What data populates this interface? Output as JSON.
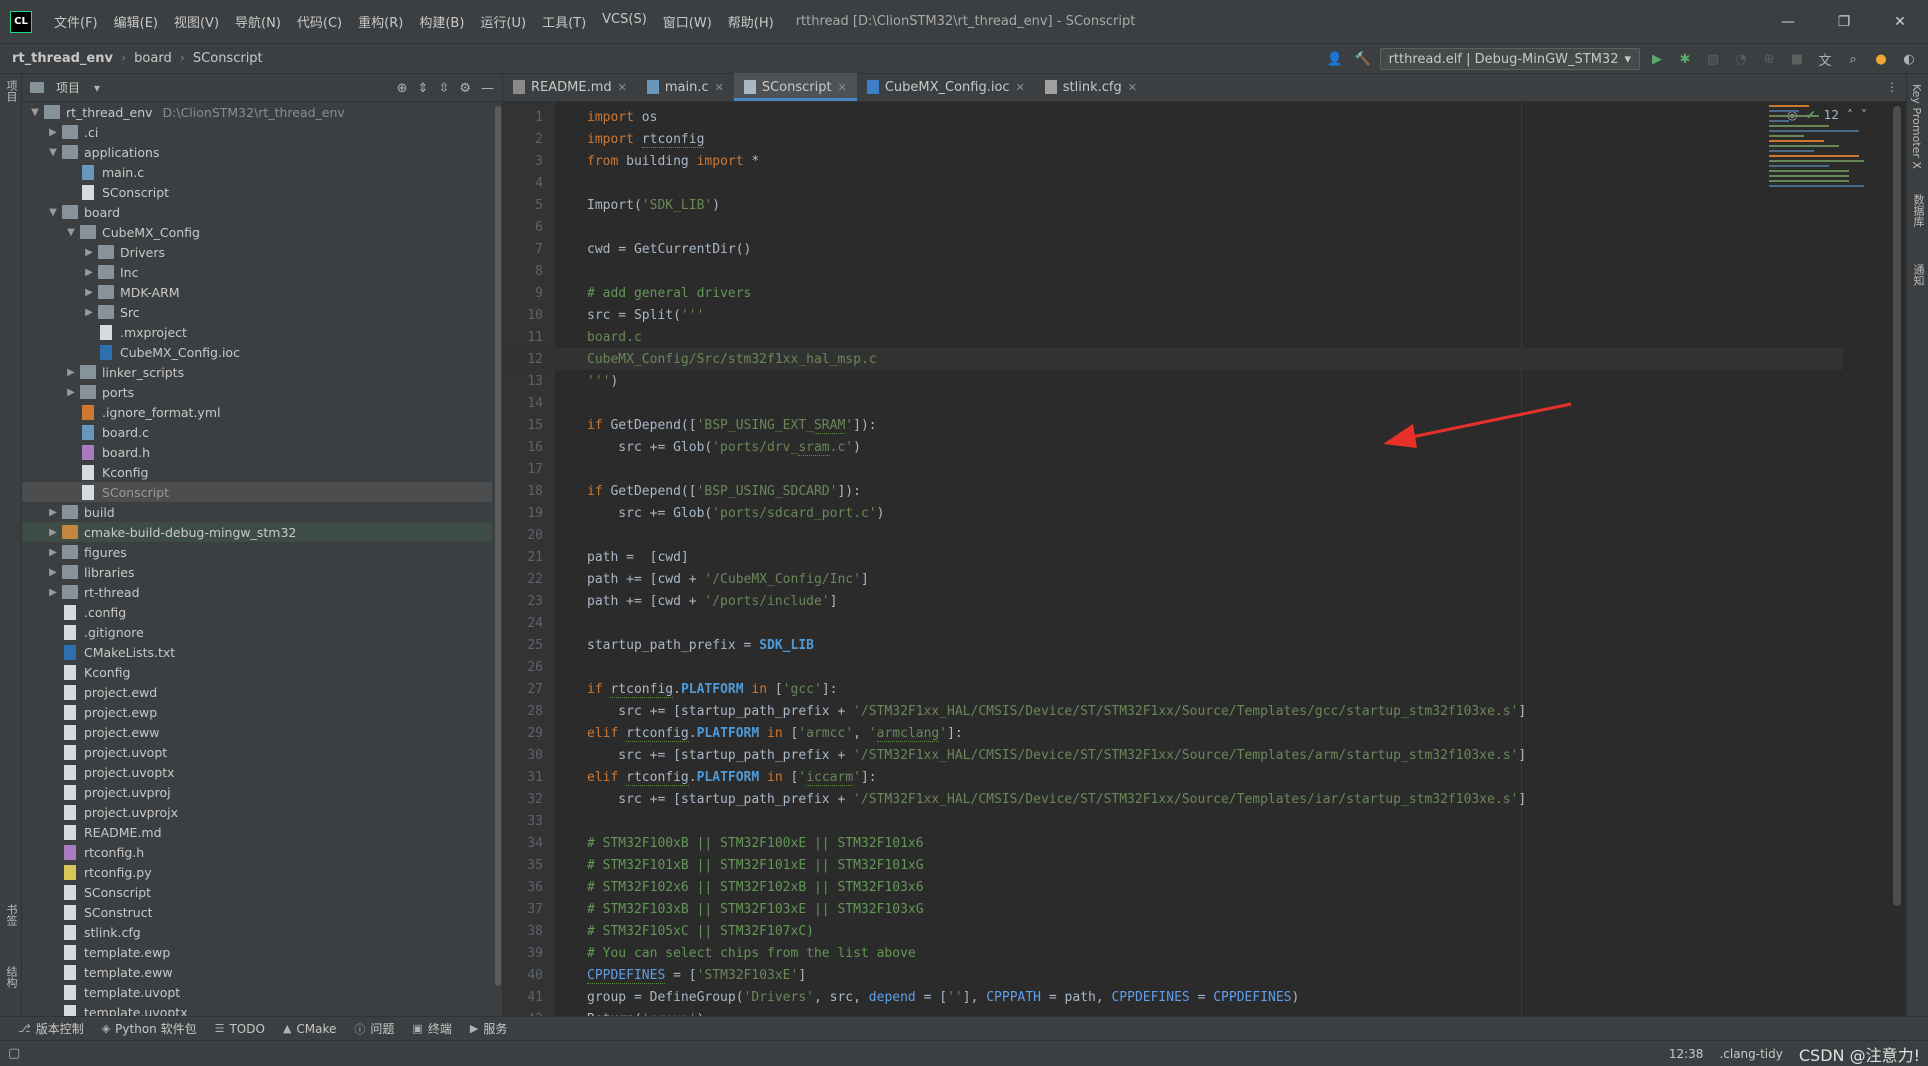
{
  "titlebar": {
    "logo": "CL",
    "menus": [
      "文件(F)",
      "编辑(E)",
      "视图(V)",
      "导航(N)",
      "代码(C)",
      "重构(R)",
      "构建(B)",
      "运行(U)",
      "工具(T)",
      "VCS(S)",
      "窗口(W)",
      "帮助(H)"
    ],
    "title": "rtthread [D:\\ClionSTM32\\rt_thread_env] - SConscript",
    "controls": [
      "—",
      "❐",
      "✕"
    ]
  },
  "navbar": {
    "breadcrumb": [
      "rt_thread_env",
      "board",
      "SConscript"
    ],
    "run_config": "rtthread.elf | Debug-MinGW_STM32"
  },
  "left_stripe": {
    "project": "项目",
    "bookmarks": "书签",
    "structure": "结构"
  },
  "right_stripe": {
    "key_promoter": "Key Promoter X",
    "database": "数据库",
    "notifications": "通知"
  },
  "project_panel": {
    "title": "项目",
    "root_name": "rt_thread_env",
    "root_path": "D:\\ClionSTM32\\rt_thread_env",
    "items": [
      {
        "name": ".ci",
        "type": "folder",
        "level": 1,
        "expanded": false
      },
      {
        "name": "applications",
        "type": "folder",
        "level": 1,
        "expanded": true
      },
      {
        "name": "main.c",
        "type": "c",
        "level": 2
      },
      {
        "name": "SConscript",
        "type": "file",
        "level": 2
      },
      {
        "name": "board",
        "type": "folder",
        "level": 1,
        "expanded": true
      },
      {
        "name": "CubeMX_Config",
        "type": "folder",
        "level": 2,
        "expanded": true
      },
      {
        "name": "Drivers",
        "type": "folder",
        "level": 3,
        "expanded": false
      },
      {
        "name": "Inc",
        "type": "folder",
        "level": 3,
        "expanded": false
      },
      {
        "name": "MDK-ARM",
        "type": "folder",
        "level": 3,
        "expanded": false
      },
      {
        "name": "Src",
        "type": "folder",
        "level": 3,
        "expanded": false
      },
      {
        "name": ".mxproject",
        "type": "file",
        "level": 3
      },
      {
        "name": "CubeMX_Config.ioc",
        "type": "cmake",
        "level": 3
      },
      {
        "name": "linker_scripts",
        "type": "folder",
        "level": 2,
        "expanded": false
      },
      {
        "name": "ports",
        "type": "folder",
        "level": 2,
        "expanded": false
      },
      {
        "name": ".ignore_format.yml",
        "type": "yml",
        "level": 2
      },
      {
        "name": "board.c",
        "type": "c",
        "level": 2
      },
      {
        "name": "board.h",
        "type": "h",
        "level": 2
      },
      {
        "name": "Kconfig",
        "type": "file",
        "level": 2
      },
      {
        "name": "SConscript",
        "type": "file",
        "level": 2,
        "selected": true
      },
      {
        "name": "build",
        "type": "folder",
        "level": 1,
        "expanded": false
      },
      {
        "name": "cmake-build-debug-mingw_stm32",
        "type": "folder-orange",
        "level": 1,
        "expanded": false,
        "highlight": true
      },
      {
        "name": "figures",
        "type": "folder",
        "level": 1,
        "expanded": false
      },
      {
        "name": "libraries",
        "type": "folder",
        "level": 1,
        "expanded": false
      },
      {
        "name": "rt-thread",
        "type": "folder",
        "level": 1,
        "expanded": false
      },
      {
        "name": ".config",
        "type": "file",
        "level": 1
      },
      {
        "name": ".gitignore",
        "type": "file",
        "level": 1
      },
      {
        "name": "CMakeLists.txt",
        "type": "cmake",
        "level": 1
      },
      {
        "name": "Kconfig",
        "type": "file",
        "level": 1
      },
      {
        "name": "project.ewd",
        "type": "file",
        "level": 1
      },
      {
        "name": "project.ewp",
        "type": "file",
        "level": 1
      },
      {
        "name": "project.eww",
        "type": "file",
        "level": 1
      },
      {
        "name": "project.uvopt",
        "type": "file",
        "level": 1
      },
      {
        "name": "project.uvoptx",
        "type": "file",
        "level": 1
      },
      {
        "name": "project.uvproj",
        "type": "file",
        "level": 1
      },
      {
        "name": "project.uvprojx",
        "type": "file",
        "level": 1
      },
      {
        "name": "README.md",
        "type": "file",
        "level": 1
      },
      {
        "name": "rtconfig.h",
        "type": "h",
        "level": 1
      },
      {
        "name": "rtconfig.py",
        "type": "py",
        "level": 1
      },
      {
        "name": "SConscript",
        "type": "file",
        "level": 1
      },
      {
        "name": "SConstruct",
        "type": "file",
        "level": 1
      },
      {
        "name": "stlink.cfg",
        "type": "file",
        "level": 1
      },
      {
        "name": "template.ewp",
        "type": "file",
        "level": 1
      },
      {
        "name": "template.eww",
        "type": "file",
        "level": 1
      },
      {
        "name": "template.uvopt",
        "type": "file",
        "level": 1
      },
      {
        "name": "template.uvoptx",
        "type": "file",
        "level": 1
      }
    ]
  },
  "editor": {
    "tabs": [
      {
        "label": "README.md",
        "icon": "md",
        "active": false
      },
      {
        "label": "main.c",
        "icon": "c",
        "active": false
      },
      {
        "label": "SConscript",
        "icon": "py",
        "active": true
      },
      {
        "label": "CubeMX_Config.ioc",
        "icon": "ioc",
        "active": false
      },
      {
        "label": "stlink.cfg",
        "icon": "cfg",
        "active": false
      }
    ],
    "inspection_count": "12",
    "current_line": 12,
    "lines": [
      "<span class='kw'>import</span> os",
      "<span class='kw'>import</span> <span class='u-line'>rtconfig</span>",
      "<span class='kw'>from</span> building <span class='kw'>import</span> *",
      "",
      "Import(<span class='str'>'SDK_LIB'</span>)",
      "",
      "cwd = GetCurrentDir()",
      "",
      "<span class='cm'># add general drivers</span>",
      "src = Split(<span class='str'>'''</span>",
      "<span class='str'>board.c</span>",
      "<span class='str'>CubeMX_Config/Src/stm32f1xx_hal_msp.c</span>",
      "<span class='str'>'''</span>)",
      "",
      "<span class='kw'>if</span> GetDepend([<span class='str'>'BSP_USING_EXT_<span class=\"u-line\">SRAM</span>'</span>]):",
      "    src += Glob(<span class='str'>'ports/drv_<span class=\"u-line\">sram</span>.c'</span>)",
      "",
      "<span class='kw'>if</span> GetDepend([<span class='str'>'BSP_USING_SDCARD'</span>]):",
      "    src += Glob(<span class='str'>'ports/sdcard_port.c'</span>)",
      "",
      "path =  [cwd]",
      "path += [cwd + <span class='str'>'/CubeMX_Config/Inc'</span>]",
      "path += [cwd + <span class='str'>'/ports/include'</span>]",
      "",
      "startup_path_prefix = <span class='bold-blue'>SDK_LIB</span>",
      "",
      "<span class='kw'>if</span> <span class='u-line'>rtconfig</span>.<span class='bold-blue'>PLATFORM</span> <span class='kw'>in</span> [<span class='str'>'gcc'</span>]:",
      "    src += [startup_path_prefix + <span class='str'>'/STM32F1xx_HAL/CMSIS/Device/ST/STM32F1xx/Source/Templates/gcc/startup_stm32f103xe.s'</span>]",
      "<span class='kw'>elif</span> <span class='u-line'>rtconfig</span>.<span class='bold-blue'>PLATFORM</span> <span class='kw'>in</span> [<span class='str'>'armcc'</span>, <span class='str'>'<span class=\"u-line\">armclang</span>'</span>]:",
      "    src += [startup_path_prefix + <span class='str'>'/STM32F1xx_HAL/CMSIS/Device/ST/STM32F1xx/Source/Templates/arm/startup_stm32f103xe.s'</span>]",
      "<span class='kw'>elif</span> <span class='u-line'>rtconfig</span>.<span class='bold-blue'>PLATFORM</span> <span class='kw'>in</span> [<span class='str'>'<span class=\"u-line\">iccarm</span>'</span>]:",
      "    src += [startup_path_prefix + <span class='str'>'/STM32F1xx_HAL/CMSIS/Device/ST/STM32F1xx/Source/Templates/iar/startup_stm32f103xe.s'</span>]",
      "",
      "<span class='cm'># STM32F100xB || STM32F100xE || STM32F101x6</span>",
      "<span class='cm'># STM32F101xB || STM32F101xE || STM32F101xG</span>",
      "<span class='cm'># STM32F102x6 || STM32F102xB || STM32F103x6</span>",
      "<span class='cm'># STM32F103xB || STM32F103xE || STM32F103xG</span>",
      "<span class='cm'># STM32F105xC || STM32F107xC)</span>",
      "<span class='cm'># You can select chips from the list above</span>",
      "<span class='const-blue u-line'>CPPDEFINES</span> = [<span class='str'>'STM32F103xE'</span>]",
      "group = DefineGroup(<span class='str'>'Drivers'</span>, src, <span class='const-blue'>depend</span> = [<span class='str'>''</span>], <span class='const-blue'>CPPPATH</span> = path, <span class='const-blue'>CPPDEFINES</span> = <span class='const-blue'>CPPDEFINES</span>)",
      "Return(<span class='str'>'group'</span>)"
    ]
  },
  "bottom_tools": [
    {
      "icon": "git-icon",
      "glyph": "⎇",
      "label": "版本控制"
    },
    {
      "icon": "python-packages-icon",
      "glyph": "◈",
      "label": "Python 软件包"
    },
    {
      "icon": "todo-icon",
      "glyph": "☰",
      "label": "TODO"
    },
    {
      "icon": "cmake-icon",
      "glyph": "▲",
      "label": "CMake"
    },
    {
      "icon": "problems-icon",
      "glyph": "ⓘ",
      "label": "问题"
    },
    {
      "icon": "terminal-icon",
      "glyph": "▣",
      "label": "终端"
    },
    {
      "icon": "services-icon",
      "glyph": "▶",
      "label": "服务"
    }
  ],
  "statusbar": {
    "position": "12:38",
    "linter": ".clang-tidy",
    "watermark": "CSDN @注意力!"
  }
}
